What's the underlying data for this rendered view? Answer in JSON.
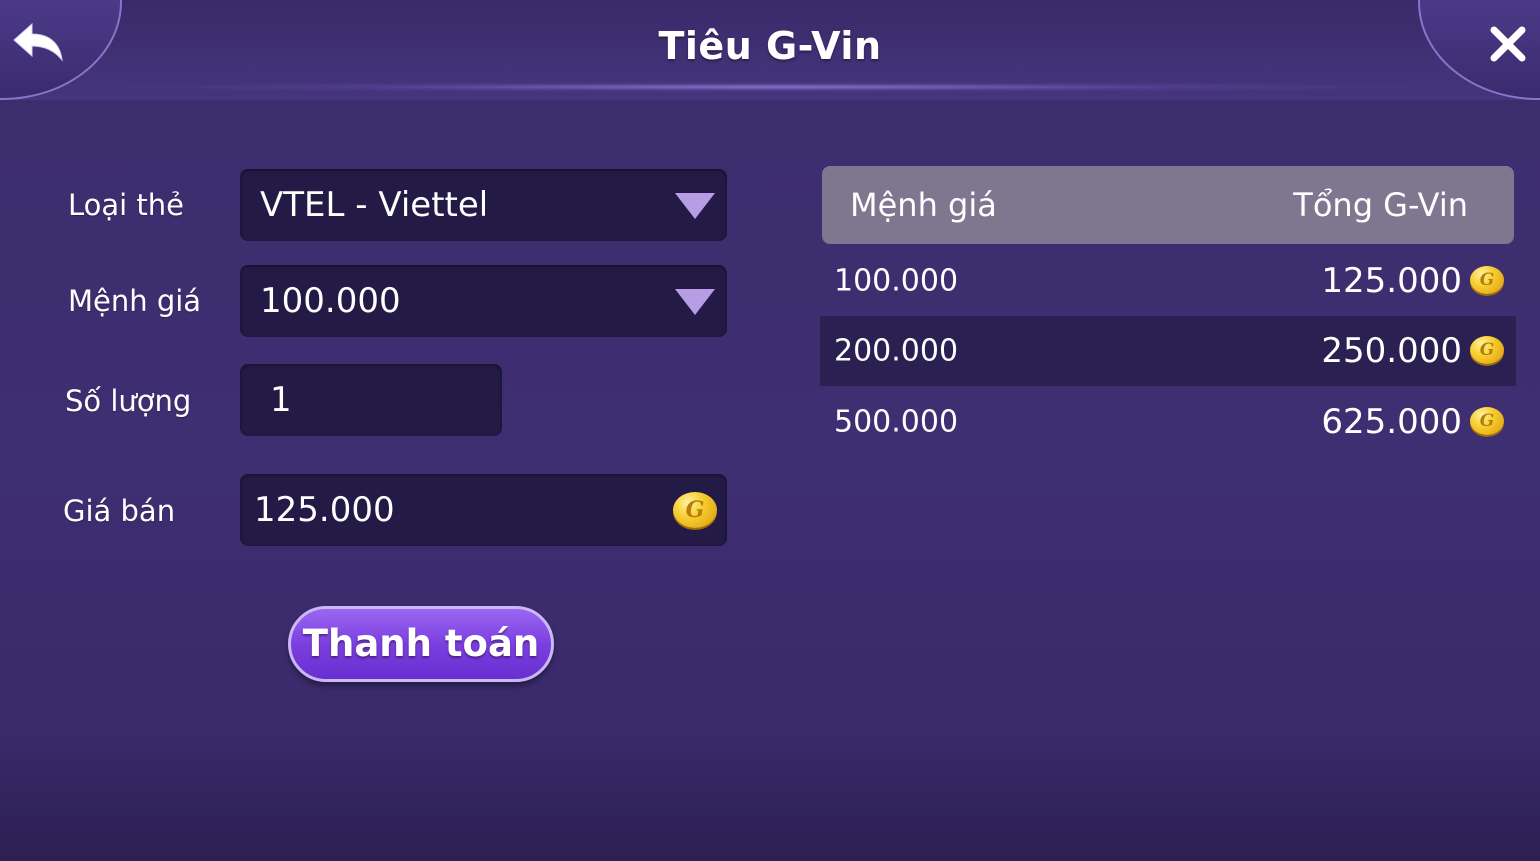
{
  "header": {
    "title": "Tiêu G-Vin"
  },
  "form": {
    "card_type_label": "Loại thẻ",
    "card_type_value": "VTEL - Viettel",
    "denomination_label": "Mệnh giá",
    "denomination_value": "100.000",
    "quantity_label": "Số lượng",
    "quantity_value": "1",
    "price_label": "Giá bán",
    "price_value": "125.000",
    "pay_button": "Thanh toán"
  },
  "table": {
    "headers": [
      "Mệnh giá",
      "Tổng G-Vin"
    ],
    "rows": [
      {
        "denomination": "100.000",
        "total": "125.000"
      },
      {
        "denomination": "200.000",
        "total": "250.000"
      },
      {
        "denomination": "500.000",
        "total": "625.000"
      }
    ]
  },
  "icons": {
    "back": "back-arrow-icon",
    "close": "close-icon",
    "dropdown": "dropdown-triangle-icon",
    "coin": "gold-coin-icon"
  },
  "colors": {
    "background": "#3e2e72",
    "field": "#231a45",
    "table_header": "#7f7790",
    "button": "#7b3fe0",
    "dropdown_arrow": "#b79ce6",
    "coin": "#f7cd2f"
  }
}
